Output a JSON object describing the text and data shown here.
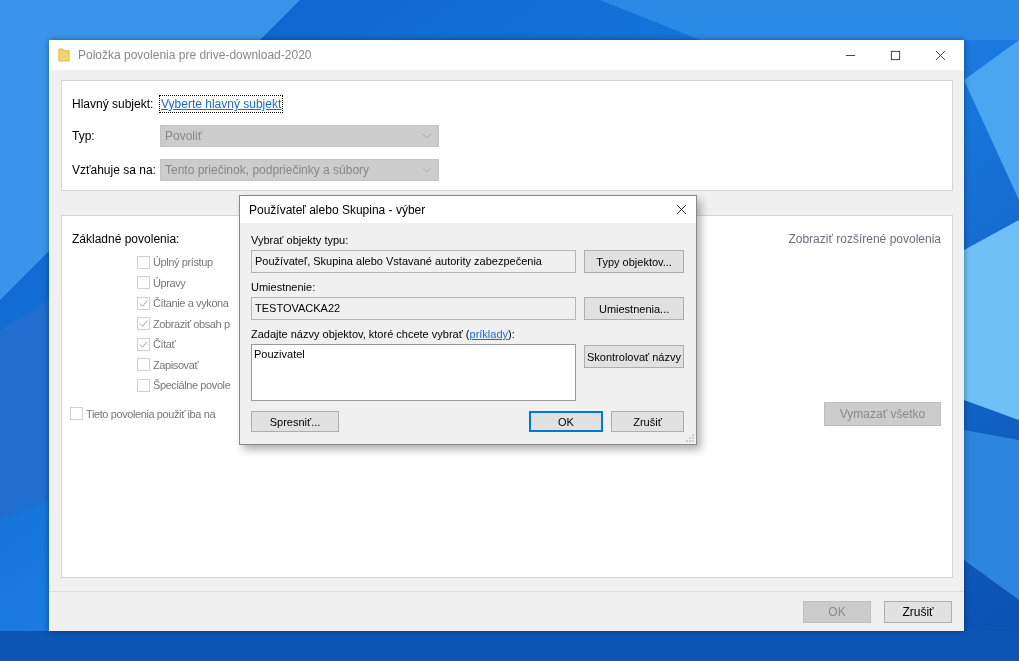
{
  "window": {
    "title": "Položka povolenia pre drive-download-2020"
  },
  "principal": {
    "label": "Hlavný subjekt:",
    "link": "Vyberte hlavný subjekt"
  },
  "fields": [
    {
      "label": "Typ:",
      "value": "Povoliť",
      "disabled": true
    },
    {
      "label": "Vzťahuje sa na:",
      "value": "Tento priečinok, podpriečinky a súbory",
      "disabled": true
    }
  ],
  "permissions": {
    "title": "Základné povolenia:",
    "link": "Zobraziť rozšírené povolenia",
    "items": [
      {
        "label": "Úplný prístup",
        "checked": false,
        "disabled": true
      },
      {
        "label": "Úpravy",
        "checked": false,
        "disabled": true
      },
      {
        "label": "Čítanie a vykona",
        "checked": true,
        "disabled": true
      },
      {
        "label": "Zobraziť obsah p",
        "checked": true,
        "disabled": true
      },
      {
        "label": "Čítať",
        "checked": true,
        "disabled": true
      },
      {
        "label": "Zapisovať",
        "checked": false,
        "disabled": true
      },
      {
        "label": "Špeciálne povole",
        "checked": false,
        "disabled": true
      }
    ]
  },
  "apply_only": {
    "label": "Tieto povolenia použiť iba na",
    "checked": false,
    "disabled": true
  },
  "clear_button": {
    "label": "Vymazať všetko",
    "disabled": true
  },
  "buttons": [
    {
      "label": "OK",
      "disabled": true
    },
    {
      "label": "Zrušiť",
      "disabled": false
    }
  ],
  "dialog": {
    "title": "Používateľ alebo Skupina - výber",
    "rows": [
      {
        "label": "Vybrať objekty typu:",
        "value": "Používateľ, Skupina alebo Vstavané autority zabezpečenia",
        "button": "Typy objektov..."
      },
      {
        "label": "Umiestnenie:",
        "value": "TESTOVACKA22",
        "button": "Umiestnenia..."
      }
    ],
    "prompt": {
      "before": "Zadajte názvy objektov, ktoré chcete vybrať (",
      "link": "príklady",
      "after": "):"
    },
    "names_value": "Pouzivatel",
    "check_button": "Skontrolovať názvy",
    "buttons": [
      {
        "label": "Spresniť...",
        "default": false
      },
      {
        "label": "OK",
        "default": true
      },
      {
        "label": "Zrušiť",
        "default": false
      }
    ]
  }
}
